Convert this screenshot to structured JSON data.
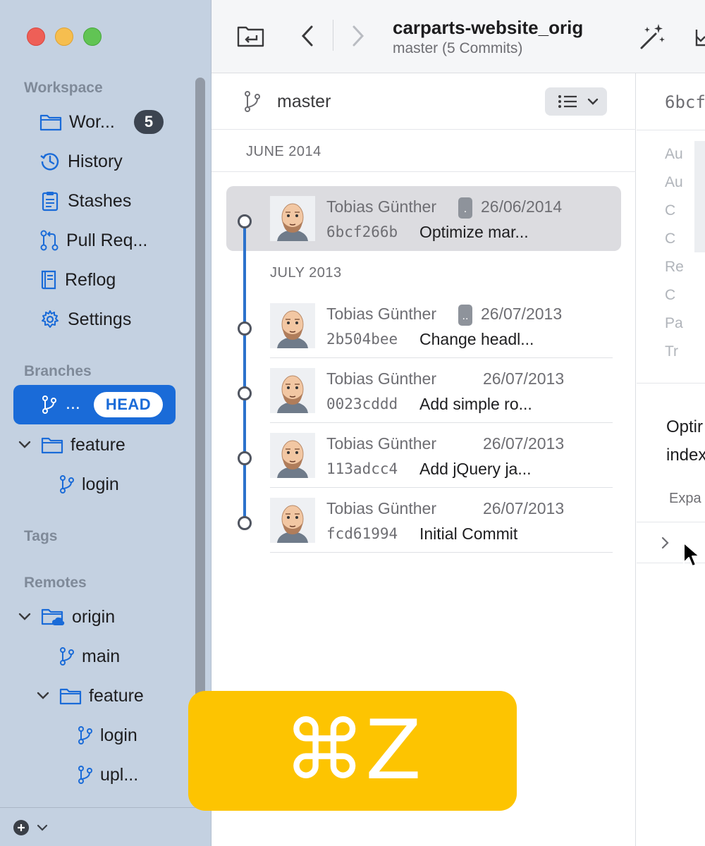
{
  "toolbar": {
    "repo_title": "carparts-website_orig",
    "repo_subtitle": "master (5 Commits)"
  },
  "sidebar": {
    "sections": {
      "workspace": "Workspace",
      "branches": "Branches",
      "tags": "Tags",
      "remotes": "Remotes"
    },
    "workspace_items": [
      {
        "label": "Wor...",
        "badge": "5"
      },
      {
        "label": "History"
      },
      {
        "label": "Stashes"
      },
      {
        "label": "Pull Req..."
      },
      {
        "label": "Reflog"
      },
      {
        "label": "Settings"
      }
    ],
    "branches": {
      "current_label": "...",
      "head_badge": "HEAD",
      "folder": "feature",
      "folder_child": "login"
    },
    "remotes": {
      "origin": "origin",
      "main": "main",
      "feature_folder": "feature",
      "feature_children": [
        "login",
        "upl..."
      ]
    }
  },
  "list": {
    "branch": "master",
    "months": [
      "JUNE 2014",
      "JULY 2013"
    ],
    "commits": [
      {
        "author": "Tobias Günther",
        "date": "26/06/2014",
        "hash": "6bcf266b",
        "message": "Optimize mar...",
        "tag": ".",
        "selected": true
      },
      {
        "author": "Tobias Günther",
        "date": "26/07/2013",
        "hash": "2b504bee",
        "message": "Change headl...",
        "tag": ".."
      },
      {
        "author": "Tobias Günther",
        "date": "26/07/2013",
        "hash": "0023cddd",
        "message": "Add simple ro..."
      },
      {
        "author": "Tobias Günther",
        "date": "26/07/2013",
        "hash": "113adcc4",
        "message": "Add jQuery ja..."
      },
      {
        "author": "Tobias Günther",
        "date": "26/07/2013",
        "hash": "fcd61994",
        "message": "Initial Commit"
      }
    ]
  },
  "detail": {
    "hash": "6bcf",
    "labels": [
      "Au",
      "Au",
      "C",
      "C",
      "Re",
      "C",
      "Pa",
      "Tr"
    ],
    "message_line1": "Optir",
    "message_line2": "index",
    "expand": "Expa"
  },
  "overlay": {
    "shortcut": "⌘Z"
  },
  "colors": {
    "accent": "#1a6bd8",
    "sidebar_bg": "#c4d1e1",
    "overlay_bg": "#fdc401",
    "graph_line": "#2b72cc"
  }
}
